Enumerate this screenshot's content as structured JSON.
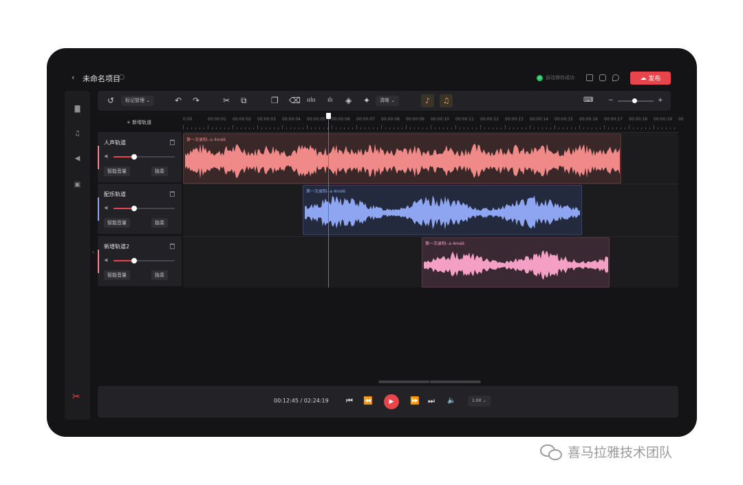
{
  "header": {
    "back_icon": "‹",
    "project_name": "未命名项目",
    "save_status": "自动保存成功",
    "save_ok_icon": "✓",
    "publish_label": "发布",
    "publish_icon": "☁"
  },
  "sidebar": {
    "items": [
      {
        "icon": "folder-icon",
        "glyph": "▇"
      },
      {
        "icon": "music-note-icon",
        "glyph": "♫"
      },
      {
        "icon": "speaker-icon",
        "glyph": "◀"
      },
      {
        "icon": "save-icon",
        "glyph": "▣"
      }
    ],
    "bottom_icon": "scissors-icon",
    "bottom_glyph": "✂"
  },
  "toolbar": {
    "undo_icon": "↶",
    "redo_icon": "↷",
    "tag_manage_label": "标记管理 ⌄",
    "denoise_label": "清晰 ⌄",
    "glyph_reset": "↺",
    "glyph_cut": "✂",
    "glyph_crop": "⧉",
    "glyph_copy": "❐",
    "glyph_delete": "⌫",
    "glyph_wave": "ıılıı",
    "glyph_bars": "ılı",
    "glyph_fx": "◈",
    "glyph_pin": "✦",
    "glyph_hl1": "♪",
    "glyph_hl2": "♫",
    "glyph_kbd": "⌨",
    "glyph_zoom_out": "−",
    "glyph_zoom_in": "+"
  },
  "add_track_label": "+ 新增轨道",
  "ruler": [
    "0:00",
    "00:00:01",
    "00:00:02",
    "00:00:03",
    "00:00:04",
    "00:00:05",
    "00:00:06",
    "00:00:07",
    "00:00:08",
    "00:00:09",
    "00:00:10",
    "00:00:11",
    "00:00:12",
    "00:00:13",
    "00:00:14",
    "00:00:15",
    "00:00:16",
    "00:00:17",
    "00:00:18",
    "00:00:19",
    "00"
  ],
  "tracks": [
    {
      "name": "人声轨道",
      "smart_volume": "智能音量",
      "voice_change": "独奏",
      "clip_label": "第一次录制--a 4mé6",
      "clip_color": "#f08a88"
    },
    {
      "name": "配乐轨道",
      "smart_volume": "智能音量",
      "voice_change": "独奏",
      "clip_label": "第一次录制--a 4mé6",
      "clip_color": "#8ea6f2"
    },
    {
      "name": "新增轨道2",
      "smart_volume": "智能音量",
      "voice_change": "独奏",
      "clip_label": "第一次录制--a 4mé6",
      "clip_color": "#f3a0c4"
    }
  ],
  "player": {
    "current_time": "00:12:45",
    "total_time": "02:24:19",
    "separator": "/",
    "speed": "1.0X ⌄",
    "glyph_skip_start": "⏮",
    "glyph_rewind": "⏪",
    "glyph_play": "▶",
    "glyph_forward": "⏩",
    "glyph_skip_end": "⏭",
    "glyph_volume": "🔈"
  },
  "watermark": "喜马拉雅技术团队",
  "colors": {
    "accent": "#e8454a",
    "bg": "#141416",
    "panel": "#232327"
  }
}
